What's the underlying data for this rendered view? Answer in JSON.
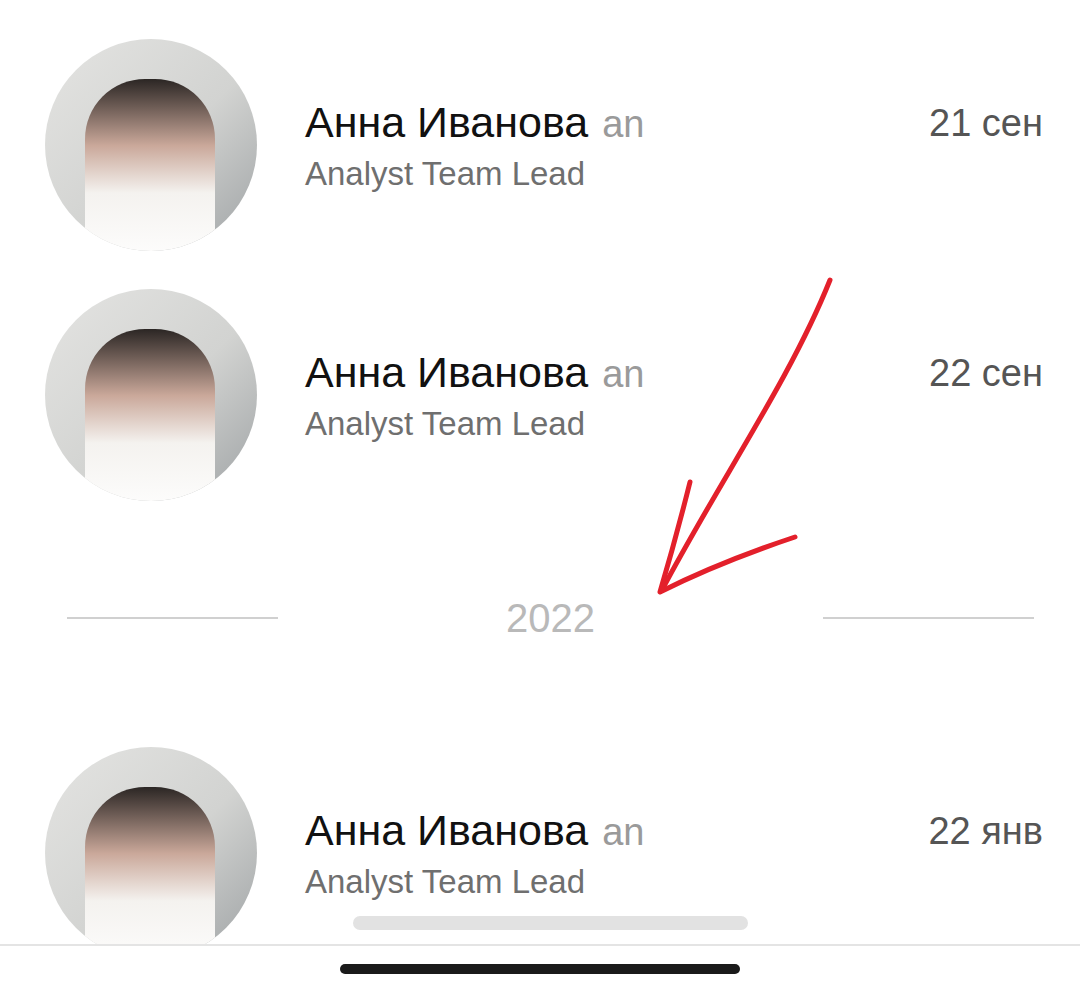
{
  "entries": [
    {
      "kind": "contact",
      "name": "Анна Иванова",
      "handle": "an",
      "role": "Analyst Team Lead",
      "date": "21 сен"
    },
    {
      "kind": "contact",
      "name": "Анна Иванова",
      "handle": "an",
      "role": "Analyst Team Lead",
      "date": "22 сен"
    },
    {
      "kind": "year-divider",
      "year": "2022"
    },
    {
      "kind": "contact",
      "name": "Анна Иванова",
      "handle": "an",
      "role": "Analyst Team Lead",
      "date": "22 янв"
    }
  ]
}
